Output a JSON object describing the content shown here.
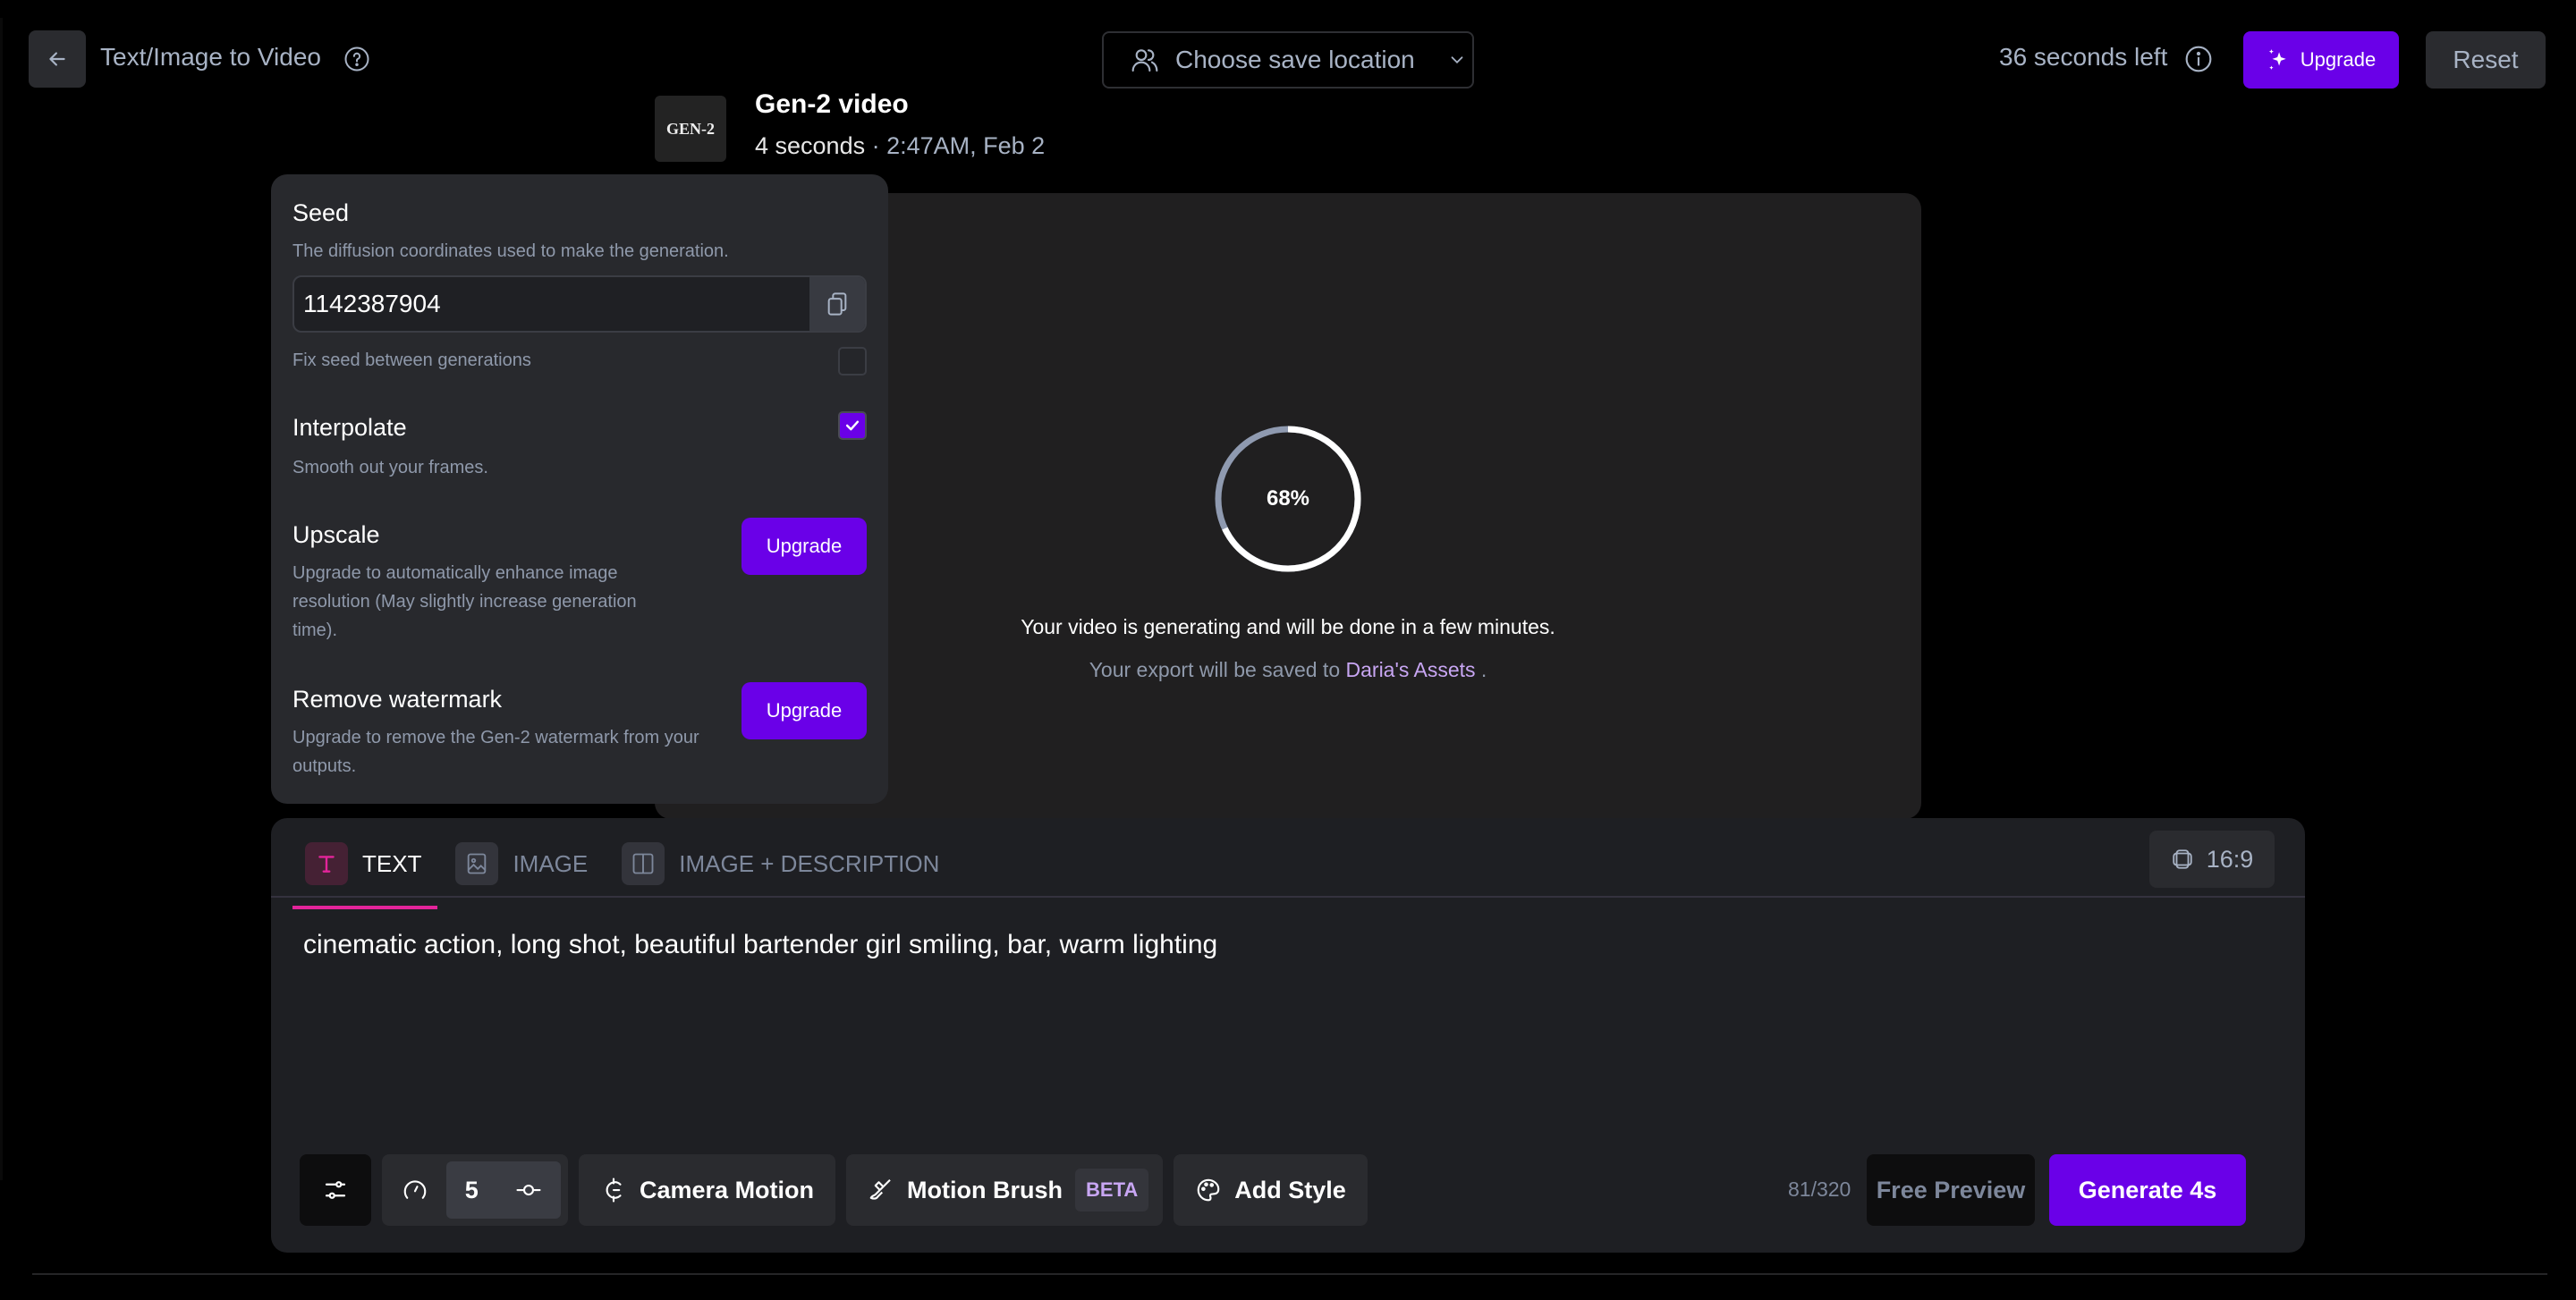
{
  "header": {
    "title": "Text/Image to Video",
    "save_location": "Choose save location",
    "time_left": "36 seconds left",
    "upgrade_label": "Upgrade",
    "reset_label": "Reset"
  },
  "generation": {
    "thumb_label": "GEN-2",
    "title": "Gen-2 video",
    "duration": "4 seconds",
    "separator": " · ",
    "timestamp": "2:47AM, Feb 2",
    "progress_percent": 68,
    "progress_label": "68%",
    "status": "Your video is generating and will be done in a few minutes.",
    "export_prefix": "Your export will be saved to ",
    "export_link": "Daria's Assets",
    "export_suffix": " ."
  },
  "settings": {
    "seed": {
      "title": "Seed",
      "description": "The diffusion coordinates used to make the generation.",
      "value": "1142387904",
      "fix_label": "Fix seed between generations",
      "fix_checked": false
    },
    "interpolate": {
      "title": "Interpolate",
      "description": "Smooth out your frames.",
      "checked": true
    },
    "upscale": {
      "title": "Upscale",
      "description": "Upgrade to automatically enhance image resolution (May slightly increase generation time).",
      "button": "Upgrade"
    },
    "watermark": {
      "title": "Remove watermark",
      "description": "Upgrade to remove the Gen-2 watermark from your outputs.",
      "button": "Upgrade"
    }
  },
  "prompt": {
    "tabs": [
      {
        "label": "TEXT",
        "active": true
      },
      {
        "label": "IMAGE",
        "active": false
      },
      {
        "label": "IMAGE + DESCRIPTION",
        "active": false
      }
    ],
    "aspect_ratio": "16:9",
    "text": "cinematic action, long shot, beautiful bartender girl smiling, bar, warm lighting",
    "char_count": "81/320"
  },
  "toolbar": {
    "motion_value": "5",
    "camera_motion": "Camera Motion",
    "motion_brush": "Motion Brush",
    "beta": "BETA",
    "add_style": "Add Style",
    "free_preview": "Free Preview",
    "generate": "Generate 4s"
  },
  "colors": {
    "accent": "#6a00e8",
    "tab_underline": "#e3249a",
    "link": "#c8a6f3",
    "muted_text": "#a8b3c5"
  }
}
